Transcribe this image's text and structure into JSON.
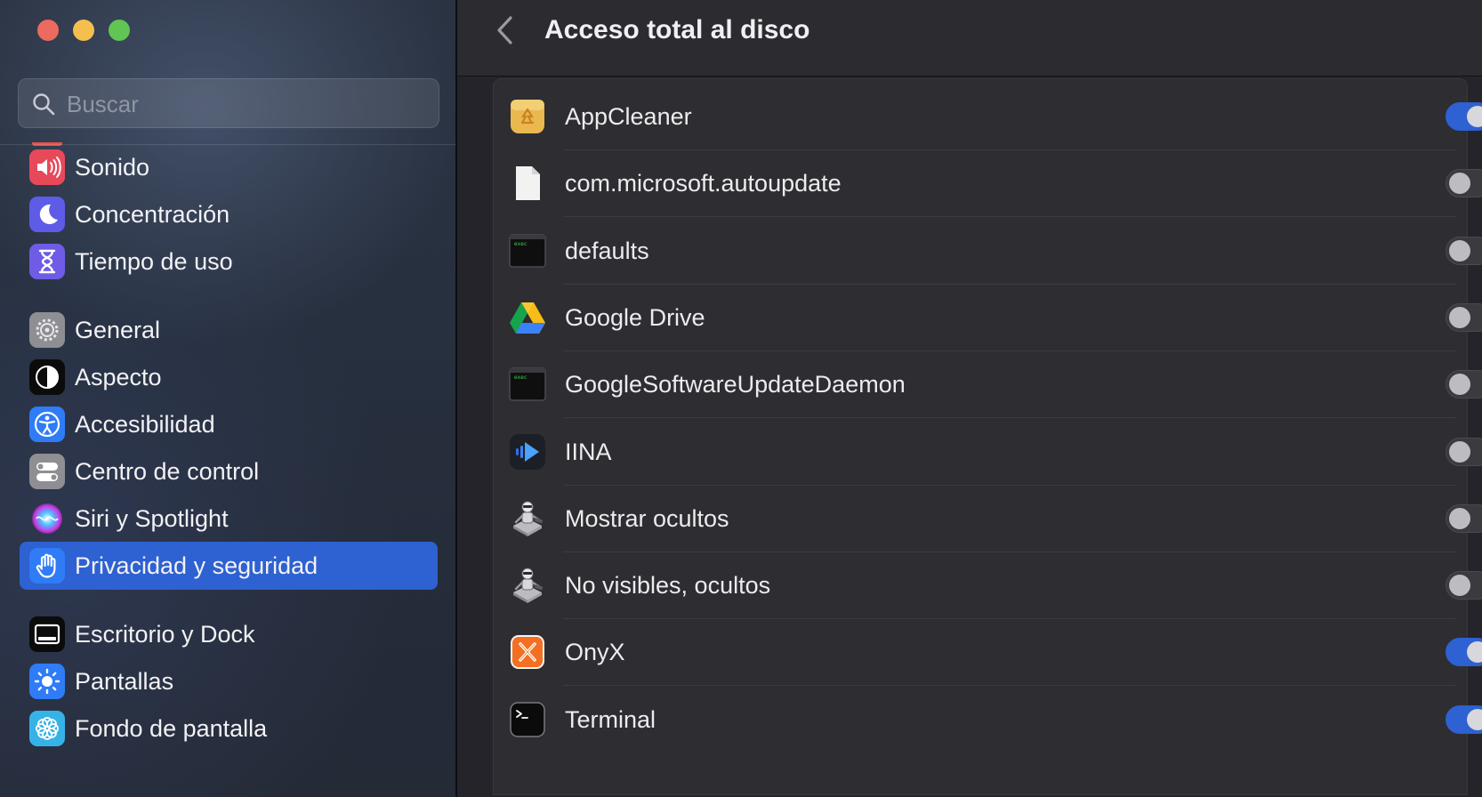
{
  "sidebar": {
    "search": {
      "placeholder": "Buscar"
    },
    "items": [
      {
        "label": "Sonido",
        "icon": "sound-icon",
        "color": "#e8495a"
      },
      {
        "label": "Concentración",
        "icon": "moon-icon",
        "color": "#5e5ce6"
      },
      {
        "label": "Tiempo de uso",
        "icon": "hourglass-icon",
        "color": "#6e5ce6"
      },
      {
        "label": "General",
        "icon": "gear-icon",
        "color": "#8e8e93"
      },
      {
        "label": "Aspecto",
        "icon": "appearance-icon",
        "color": "#1c1c1e"
      },
      {
        "label": "Accesibilidad",
        "icon": "accessibility-icon",
        "color": "#2f7cf6"
      },
      {
        "label": "Centro de control",
        "icon": "control-center-icon",
        "color": "#8e8e93"
      },
      {
        "label": "Siri y Spotlight",
        "icon": "siri-icon",
        "color": "#b03ae0"
      },
      {
        "label": "Privacidad y seguridad",
        "icon": "hand-icon",
        "color": "#2f7cf6",
        "selected": true
      },
      {
        "label": "Escritorio y Dock",
        "icon": "dock-icon",
        "color": "#1c1c1e"
      },
      {
        "label": "Pantallas",
        "icon": "sun-icon",
        "color": "#2f7cf6"
      },
      {
        "label": "Fondo de pantalla",
        "icon": "flower-icon",
        "color": "#36b3e6"
      }
    ]
  },
  "header": {
    "title": "Acceso total al disco"
  },
  "apps": [
    {
      "name": "AppCleaner",
      "icon": "appcleaner-icon",
      "enabled": true
    },
    {
      "name": "com.microsoft.autoupdate",
      "icon": "document-icon",
      "enabled": false
    },
    {
      "name": "defaults",
      "icon": "exec-icon",
      "enabled": false
    },
    {
      "name": "Google Drive",
      "icon": "google-drive-icon",
      "enabled": false
    },
    {
      "name": "GoogleSoftwareUpdateDaemon",
      "icon": "exec-icon",
      "enabled": false
    },
    {
      "name": "IINA",
      "icon": "iina-icon",
      "enabled": false
    },
    {
      "name": "Mostrar ocultos",
      "icon": "automator-icon",
      "enabled": false
    },
    {
      "name": "No visibles, ocultos",
      "icon": "automator-icon",
      "enabled": false
    },
    {
      "name": "OnyX",
      "icon": "onyx-icon",
      "enabled": true
    },
    {
      "name": "Terminal",
      "icon": "terminal-icon",
      "enabled": true
    }
  ],
  "colors": {
    "accent": "#2e61d1",
    "sidebar_selection": "#2e61d1"
  },
  "exec_label": "exec"
}
